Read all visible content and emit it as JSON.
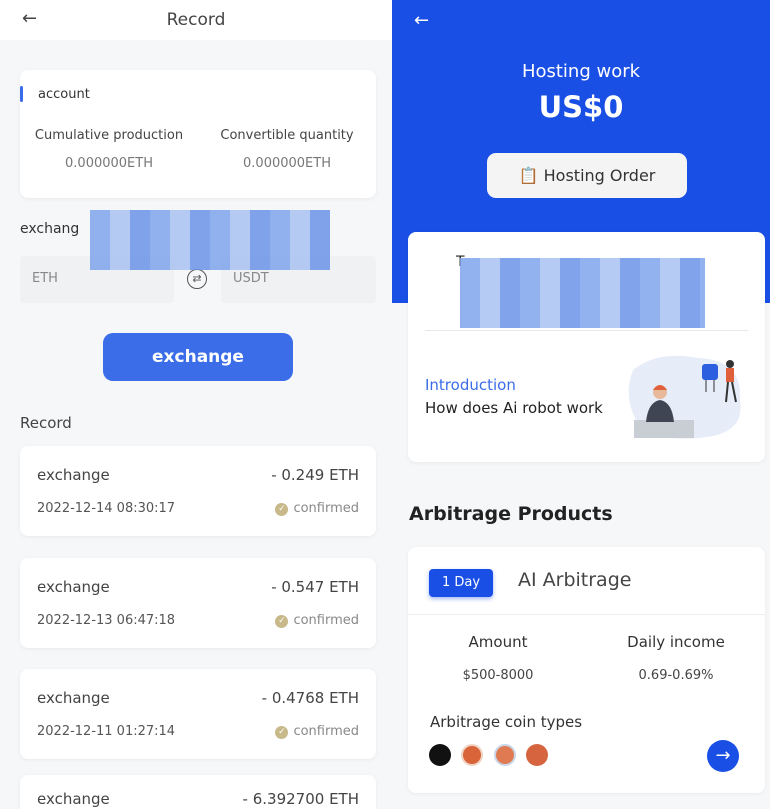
{
  "left": {
    "header": {
      "title": "Record",
      "back_icon": "arrow-left-icon"
    },
    "account": {
      "label": "account",
      "cumulative_label": "Cumulative production",
      "cumulative_value": "0.000000ETH",
      "convertible_label": "Convertible quantity",
      "convertible_value": "0.000000ETH"
    },
    "exchange_label": "exchang",
    "from_currency": "ETH",
    "to_currency": "USDT",
    "exchange_button": "exchange",
    "record_heading": "Record",
    "records": [
      {
        "type": "exchange",
        "amount": "- 0.249 ETH",
        "time": "2022-12-14 08:30:17",
        "status": "confirmed"
      },
      {
        "type": "exchange",
        "amount": "- 0.547 ETH",
        "time": "2022-12-13 06:47:18",
        "status": "confirmed"
      },
      {
        "type": "exchange",
        "amount": "- 0.4768 ETH",
        "time": "2022-12-11 01:27:14",
        "status": "confirmed"
      },
      {
        "type": "exchange",
        "amount": "- 6.392700 ETH"
      }
    ]
  },
  "right": {
    "title": "Hosting work",
    "amount": "US$0",
    "hosting_order": "Hosting Order",
    "info_partial": "T",
    "intro_label": "Introduction",
    "intro_text": "How does Ai robot work",
    "section_title": "Arbitrage Products",
    "product": {
      "badge": "1 Day",
      "name": "AI Arbitrage",
      "amount_label": "Amount",
      "amount_value": "$500-8000",
      "income_label": "Daily income",
      "income_value": "0.69-0.69%",
      "coin_types_label": "Arbitrage coin types"
    },
    "accent": "#1a4fe6"
  }
}
